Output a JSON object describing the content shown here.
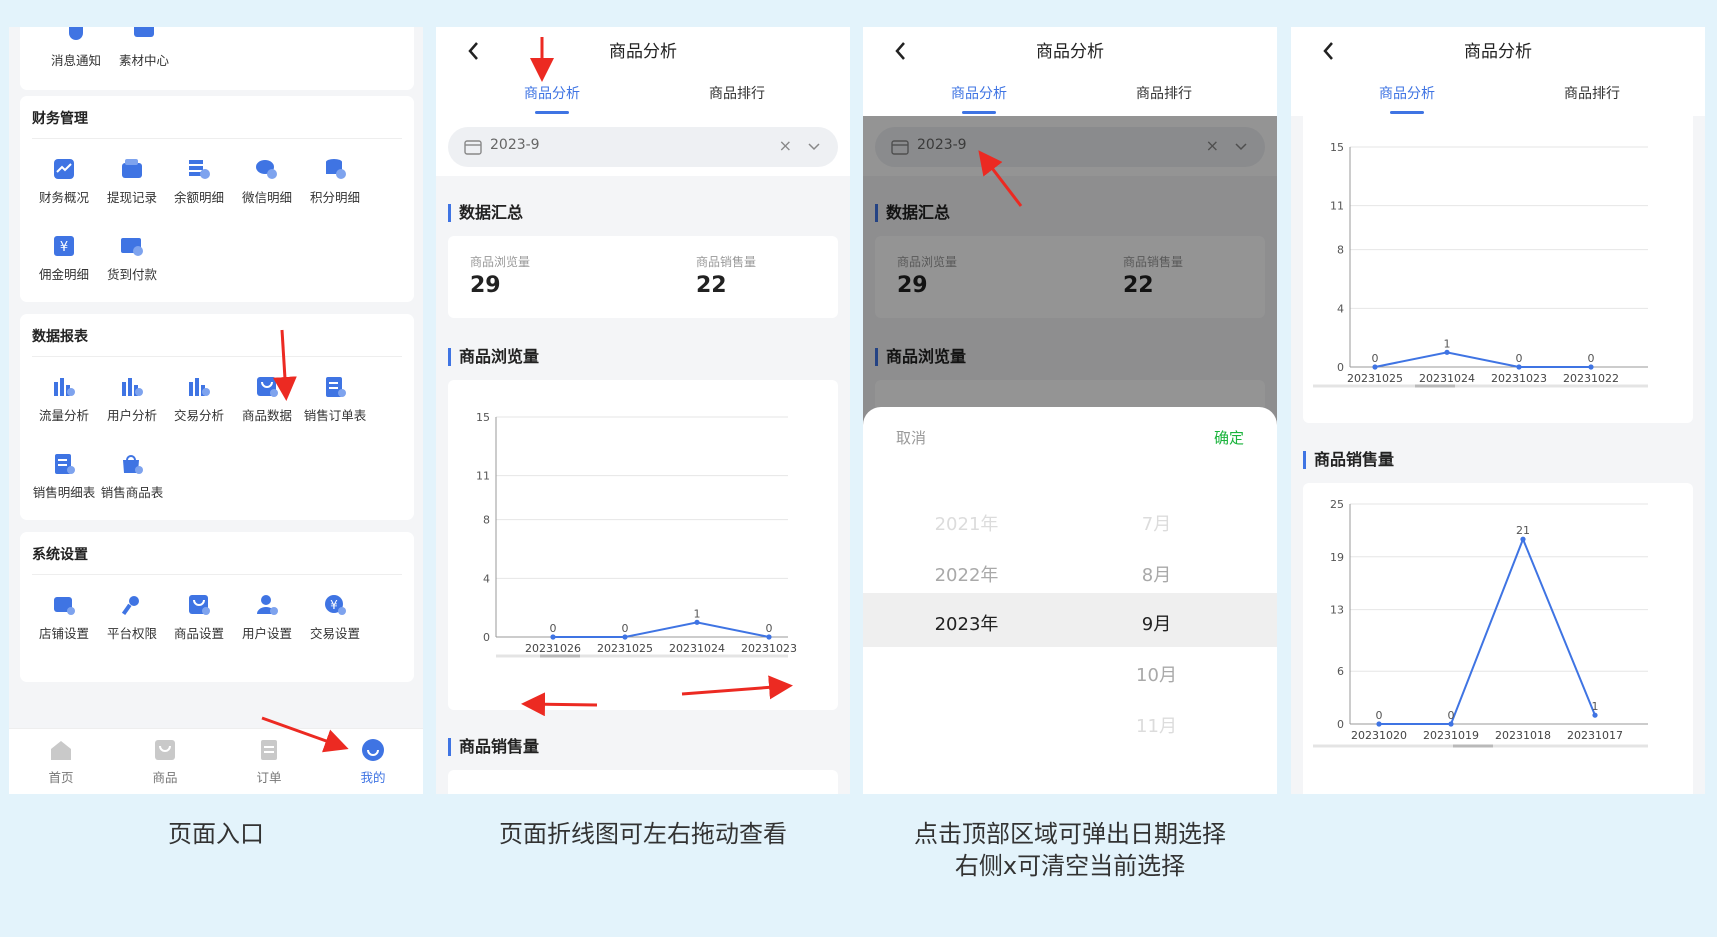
{
  "colors": {
    "accent": "#3f74e3",
    "arrow": "#ec2a22",
    "confirm": "#19b33b",
    "background": "#e3f3fb"
  },
  "panel1": {
    "top_items": [
      {
        "label": "消息通知",
        "icon": "bell-icon"
      },
      {
        "label": "素材中心",
        "icon": "material-icon"
      }
    ],
    "finance": {
      "title": "财务管理",
      "items": [
        {
          "label": "财务概况",
          "icon": "finance-overview-icon"
        },
        {
          "label": "提现记录",
          "icon": "wallet-icon"
        },
        {
          "label": "余额明细",
          "icon": "balance-icon"
        },
        {
          "label": "微信明细",
          "icon": "wechat-icon"
        },
        {
          "label": "积分明细",
          "icon": "points-icon"
        },
        {
          "label": "佣金明细",
          "icon": "commission-icon"
        },
        {
          "label": "货到付款",
          "icon": "cod-icon"
        }
      ]
    },
    "reports": {
      "title": "数据报表",
      "items": [
        {
          "label": "流量分析",
          "icon": "traffic-chart-icon"
        },
        {
          "label": "用户分析",
          "icon": "user-chart-icon"
        },
        {
          "label": "交易分析",
          "icon": "trade-chart-icon"
        },
        {
          "label": "商品数据",
          "icon": "product-data-icon"
        },
        {
          "label": "销售订单表",
          "icon": "sales-order-icon"
        },
        {
          "label": "销售明细表",
          "icon": "sales-detail-icon"
        },
        {
          "label": "销售商品表",
          "icon": "sales-product-icon"
        }
      ]
    },
    "settings": {
      "title": "系统设置",
      "items": [
        {
          "label": "店铺设置",
          "icon": "store-settings-icon"
        },
        {
          "label": "平台权限",
          "icon": "key-icon"
        },
        {
          "label": "商品设置",
          "icon": "product-settings-icon"
        },
        {
          "label": "用户设置",
          "icon": "user-settings-icon"
        },
        {
          "label": "交易设置",
          "icon": "trade-settings-icon"
        }
      ]
    },
    "tabbar": [
      {
        "label": "首页",
        "icon": "home-icon"
      },
      {
        "label": "商品",
        "icon": "goods-icon"
      },
      {
        "label": "订单",
        "icon": "order-icon"
      },
      {
        "label": "我的",
        "icon": "profile-icon"
      }
    ]
  },
  "analysis": {
    "title": "商品分析",
    "tabs": [
      "商品分析",
      "商品排行"
    ],
    "date": "2023-9",
    "clear": "×",
    "summary_title": "数据汇总",
    "views_label": "商品浏览量",
    "views_value": "29",
    "sales_label": "商品销售量",
    "sales_value": "22",
    "views_section": "商品浏览量",
    "sales_section": "商品销售量"
  },
  "picker": {
    "cancel": "取消",
    "confirm": "确定",
    "years": [
      "2021年",
      "2022年",
      "2023年"
    ],
    "months": [
      "7月",
      "8月",
      "9月",
      "10月",
      "11月"
    ],
    "selected_year": "2023年",
    "selected_month": "9月"
  },
  "captions": [
    "页面入口",
    "页面折线图可左右拖动查看",
    "点击顶部区域可弹出日期选择",
    "右侧x可清空当前选择"
  ],
  "chart_data": [
    {
      "type": "line",
      "chart": "views-panel2",
      "categories": [
        "20231026",
        "20231025",
        "20231024",
        "20231023"
      ],
      "values": [
        0,
        0,
        1,
        0
      ],
      "yticks": [
        0,
        4,
        8,
        11,
        15
      ],
      "ylim": [
        0,
        15
      ]
    },
    {
      "type": "line",
      "chart": "views-panel4",
      "categories": [
        "20231025",
        "20231024",
        "20231023",
        "20231022"
      ],
      "values": [
        0,
        1,
        0,
        0
      ],
      "yticks": [
        0,
        4,
        8,
        11,
        15
      ],
      "ylim": [
        0,
        15
      ]
    },
    {
      "type": "line",
      "chart": "sales-panel4",
      "categories": [
        "20231020",
        "20231019",
        "20231018",
        "20231017"
      ],
      "values": [
        0,
        0,
        21,
        1
      ],
      "yticks": [
        0,
        6,
        13,
        19,
        25
      ],
      "ylim": [
        0,
        25
      ]
    }
  ]
}
